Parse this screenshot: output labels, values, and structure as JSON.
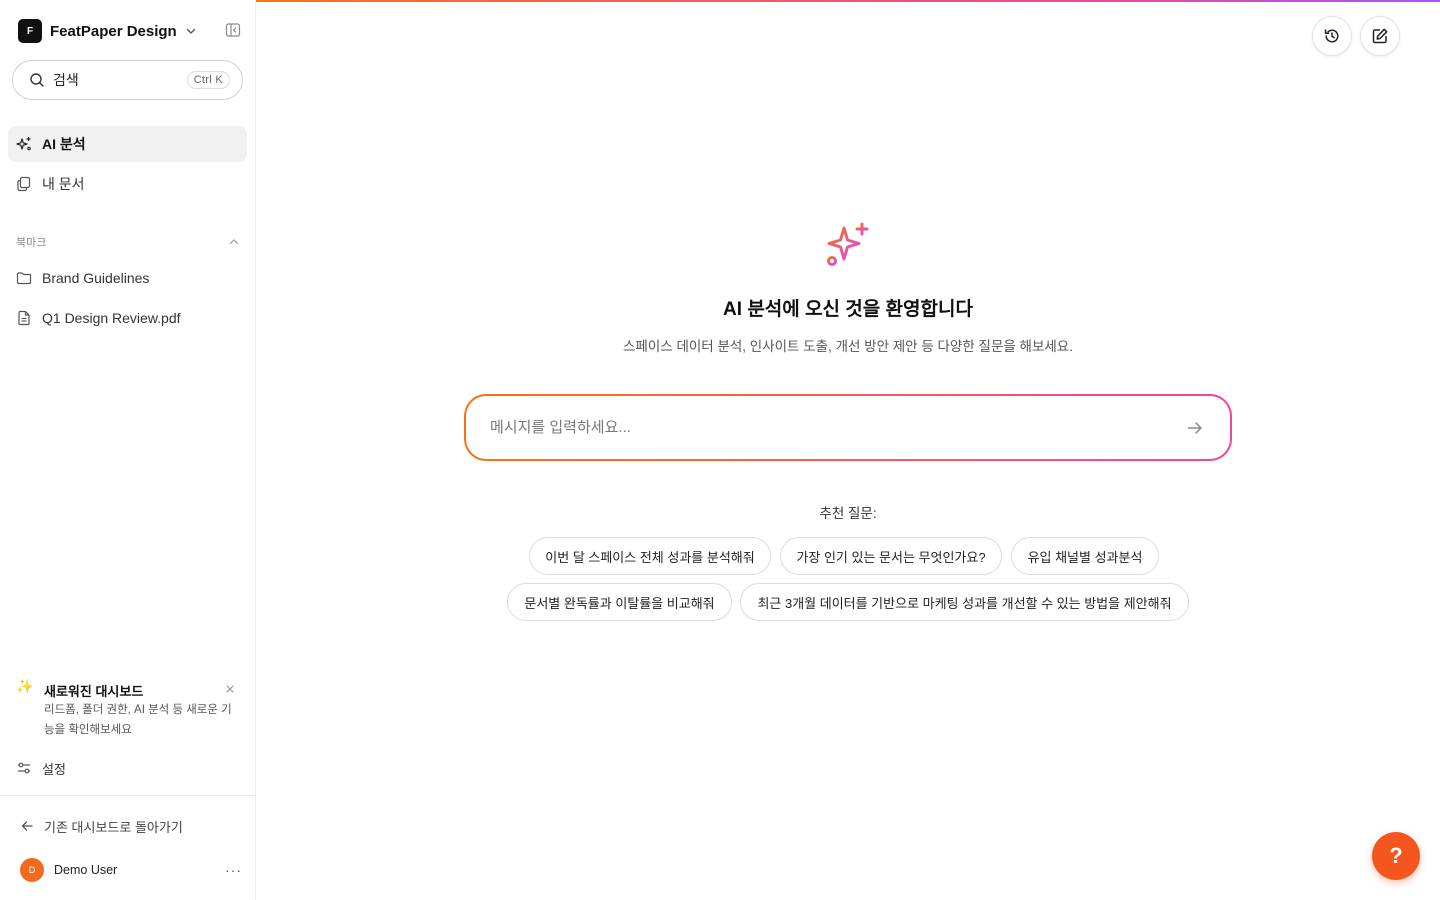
{
  "workspace": {
    "logo_letter": "F",
    "name": "FeatPaper Design"
  },
  "search": {
    "label": "검색",
    "shortcut": "Ctrl K"
  },
  "nav": {
    "items": [
      {
        "label": "AI 분석",
        "icon": "sparkles-icon",
        "active": true
      },
      {
        "label": "내 문서",
        "icon": "documents-icon",
        "active": false
      }
    ]
  },
  "bookmarks": {
    "title": "북마크",
    "items": [
      {
        "label": "Brand Guidelines",
        "icon": "folder-icon"
      },
      {
        "label": "Q1 Design Review.pdf",
        "icon": "file-icon"
      }
    ]
  },
  "promo": {
    "icon": "✨",
    "title": "새로워진 대시보드",
    "description": "리드폼, 폴더 권한, AI 분석 등 새로운 기능을 확인해보세요"
  },
  "settings": {
    "label": "설정"
  },
  "back_link": {
    "label": "기존 대시보드로 돌아가기"
  },
  "user": {
    "initial": "D",
    "name": "Demo User",
    "menu": "···"
  },
  "main": {
    "title": "AI 분석에 오신 것을 환영합니다",
    "subtitle": "스페이스 데이터 분석, 인사이트 도출, 개선 방안 제안 등 다양한 질문을 해보세요.",
    "input_placeholder": "메시지를 입력하세요...",
    "suggestions_label": "추천 질문:",
    "suggestions": [
      "이번 달 스페이스 전체 성과를 분석해줘",
      "가장 인기 있는 문서는 무엇인가요?",
      "유입 채널별 성과분석",
      "문서별 완독률과 이탈률을 비교해줘",
      "최근 3개월 데이터를 기반으로 마케팅 성과를 개선할 수 있는 방법을 제안해줘"
    ]
  },
  "help": {
    "label": "?"
  },
  "colors": {
    "accent_orange": "#f97316",
    "accent_pink": "#ec4899",
    "help_button": "#f4561e"
  }
}
